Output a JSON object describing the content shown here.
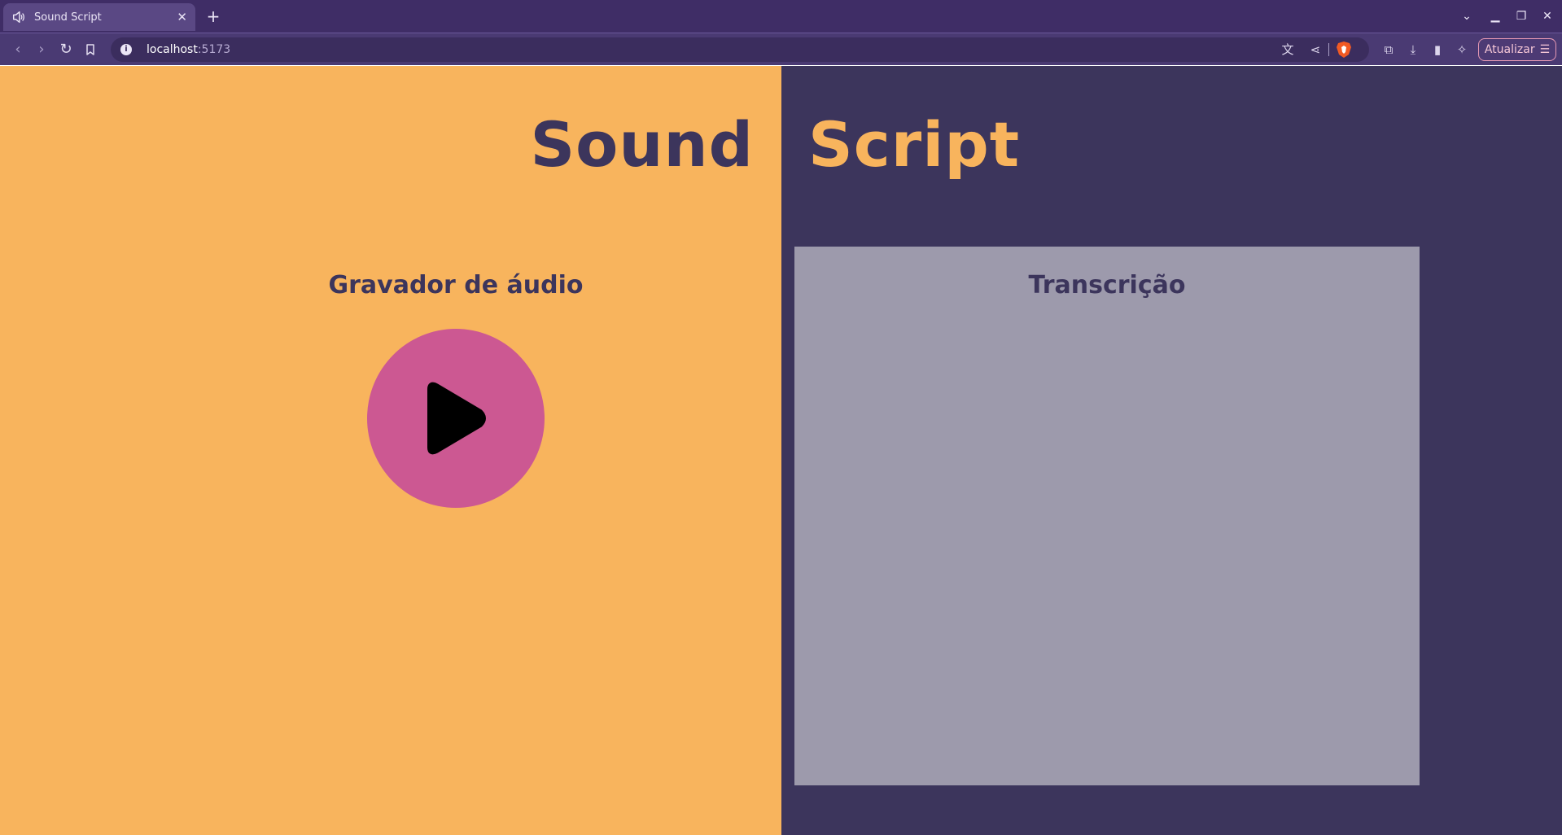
{
  "browser": {
    "tab": {
      "title": "Sound Script",
      "icon": "speaker-icon"
    },
    "url": {
      "host": "localhost",
      "port": ":5173"
    },
    "update_label": "Atualizar",
    "accent": "#3f2d66"
  },
  "app": {
    "title_part1": "Sound",
    "title_part2": "Script",
    "recorder_heading": "Gravador de áudio",
    "transcript_heading": "Transcrição",
    "transcript_text": "",
    "colors": {
      "left_bg": "#f8b45d",
      "right_bg": "#3c355c",
      "play_button": "#cc5892",
      "transcript_bg": "#9d9aac"
    }
  }
}
